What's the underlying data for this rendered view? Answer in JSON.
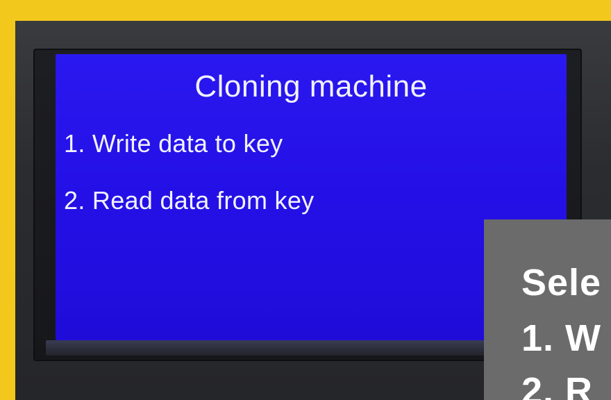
{
  "screen": {
    "title": "Cloning machine",
    "menu": [
      {
        "label": "1. Write data to key"
      },
      {
        "label": "2. Read data from key"
      }
    ]
  },
  "overlay": {
    "lines": [
      "Sele",
      "1. W",
      "2. R"
    ]
  },
  "colors": {
    "frame": "#f3c81c",
    "screen": "#2410e6",
    "overlay": "#6b6b6b"
  }
}
